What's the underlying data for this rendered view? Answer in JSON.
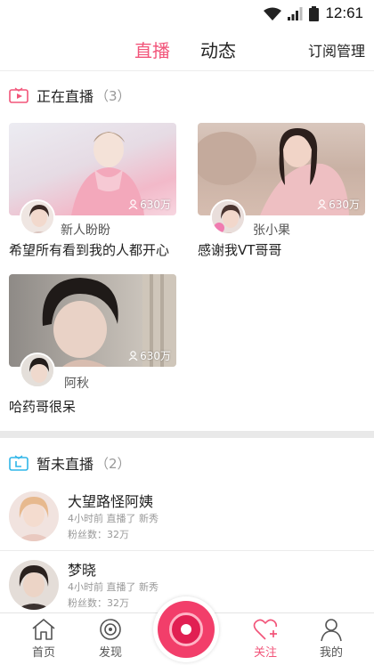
{
  "status_bar": {
    "time": "12:61"
  },
  "top_nav": {
    "tabs": [
      {
        "label": "直播",
        "active": true
      },
      {
        "label": "动态",
        "active": false
      }
    ],
    "right_label": "订阅管理"
  },
  "live_section": {
    "title": "正在直播",
    "count": "（3）",
    "cards": [
      {
        "streamer": "新人盼盼",
        "viewers": "630万",
        "caption": "希望所有看到我的人都开心"
      },
      {
        "streamer": "张小果",
        "viewers": "630万",
        "caption": "感谢我VT哥哥"
      },
      {
        "streamer": "阿秋",
        "viewers": "630万",
        "caption": "哈药哥很呆"
      }
    ]
  },
  "offline_section": {
    "title": "暂未直播",
    "count": "（2）",
    "items": [
      {
        "name": "大望路怪阿姨",
        "meta": "4小时前  直播了  新秀",
        "fans": "粉丝数：32万"
      },
      {
        "name": "梦晓",
        "meta": "4小时前  直播了  新秀",
        "fans": "粉丝数：32万"
      }
    ]
  },
  "bottom_tabs": [
    {
      "label": "首页",
      "icon": "home-icon"
    },
    {
      "label": "发现",
      "icon": "discover-icon"
    },
    {
      "label": "关注",
      "icon": "heart-plus-icon",
      "active": true
    },
    {
      "label": "我的",
      "icon": "user-icon"
    }
  ],
  "colors": {
    "accent": "#f2557a",
    "record": "#f23e6a",
    "divider": "#e9e9e9"
  }
}
